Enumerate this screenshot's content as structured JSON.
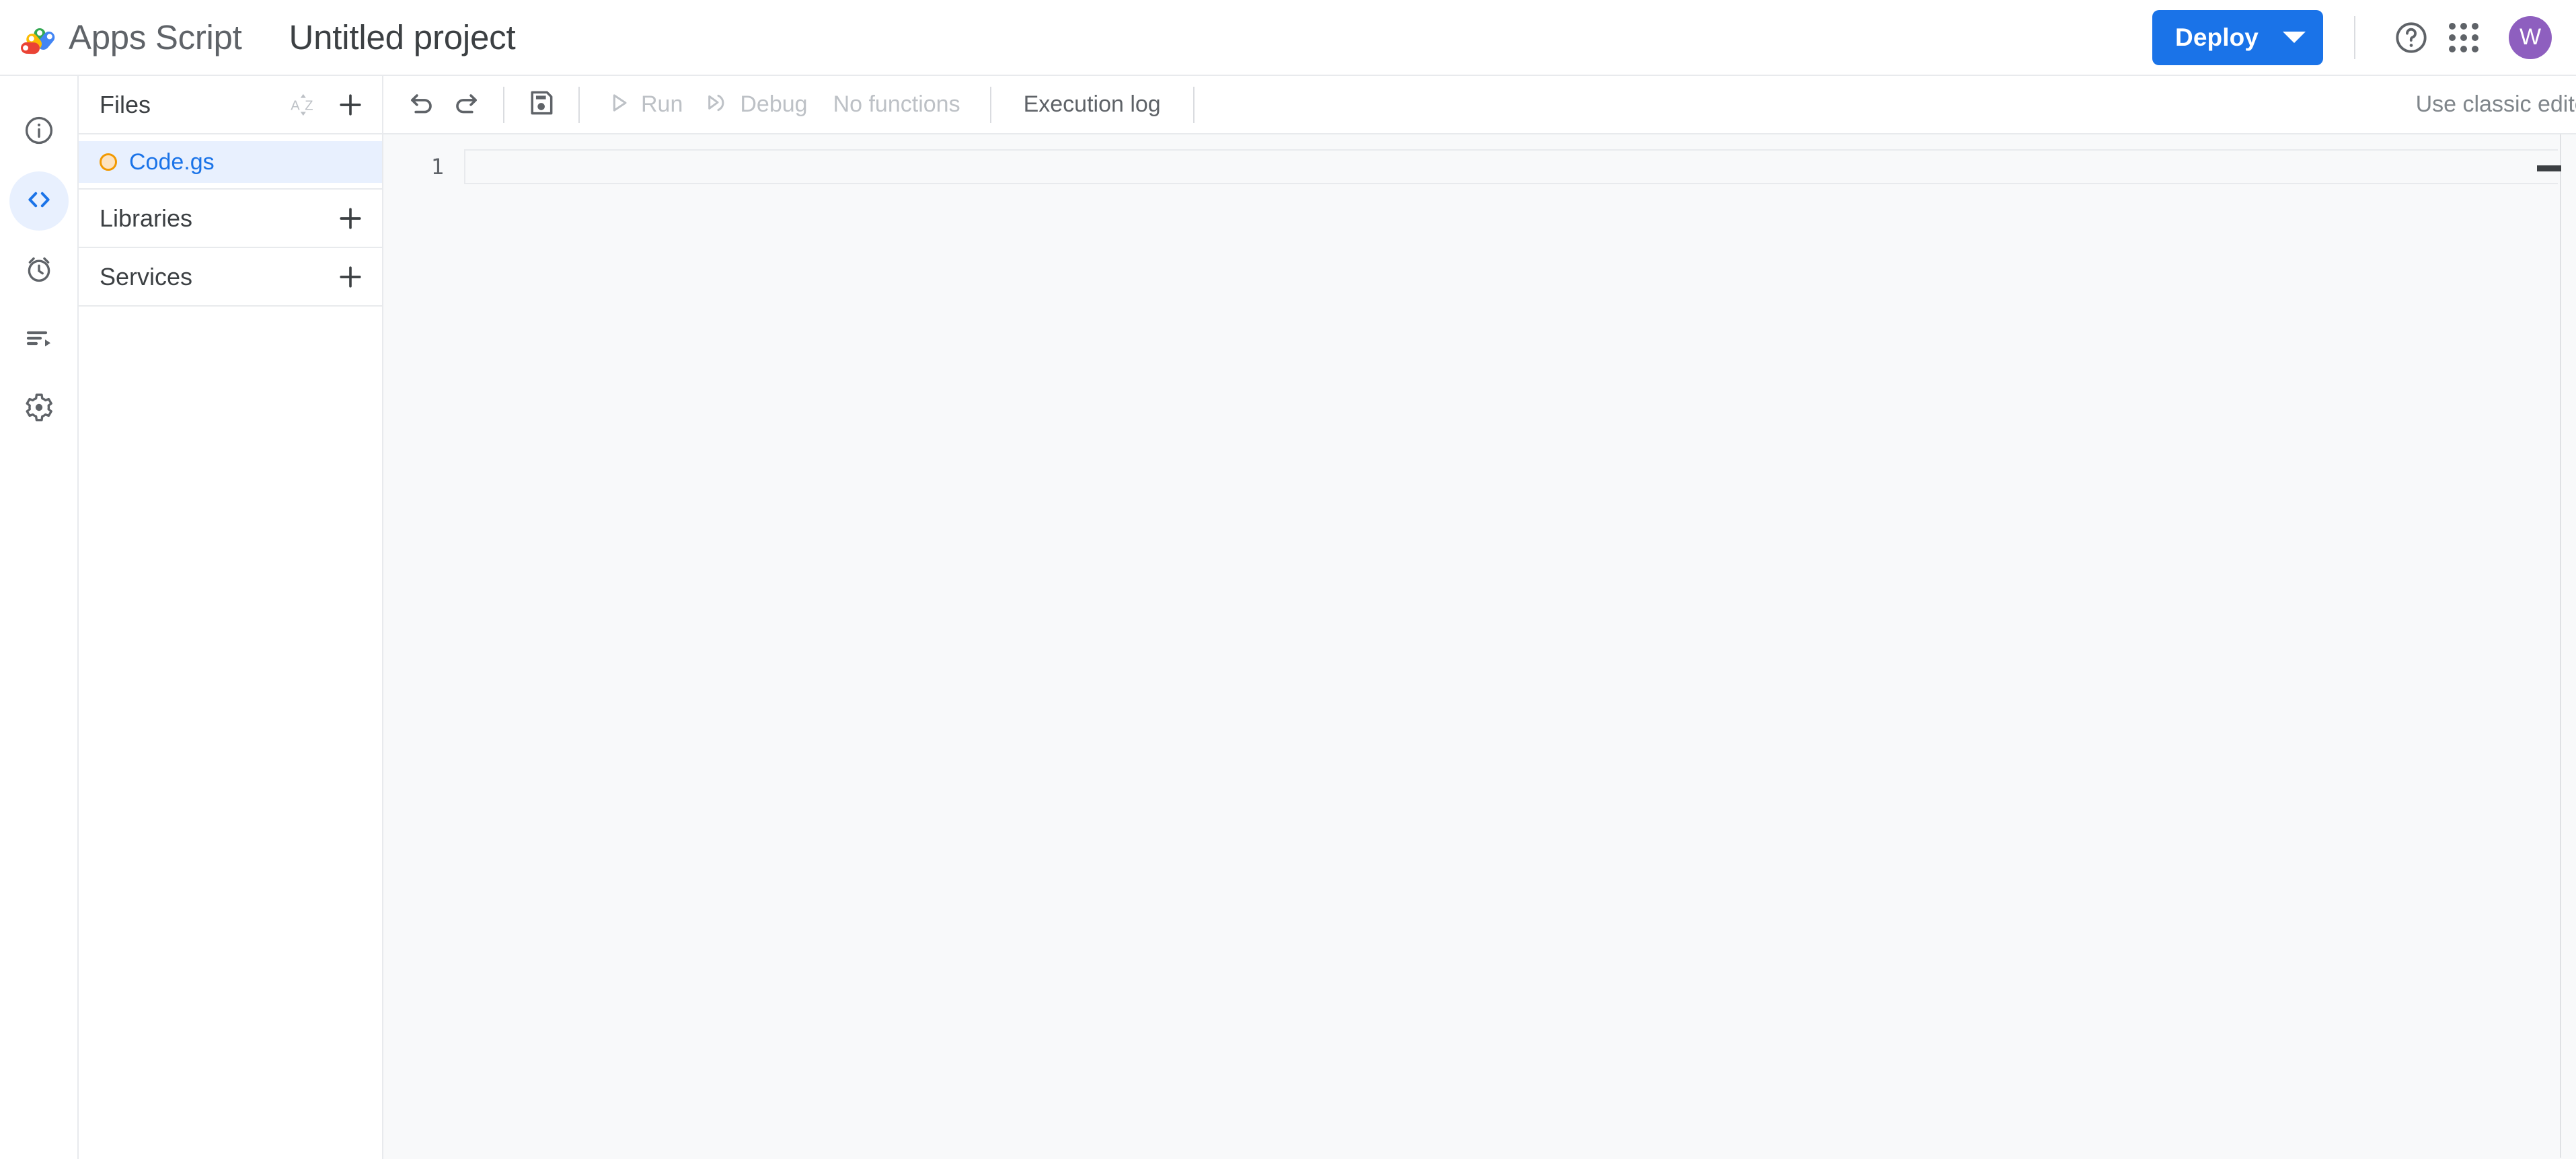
{
  "header": {
    "logo_icon": "apps-script-logo",
    "brand": "Apps Script",
    "project_title": "Untitled project",
    "deploy_label": "Deploy",
    "deploy_caret_icon": "chevron-down-icon",
    "help_icon": "help-circle-icon",
    "apps_icon": "apps-grid-icon",
    "avatar_initial": "W",
    "accent_color": "#1a73e8",
    "avatar_color": "#8e5fbf"
  },
  "rail": {
    "items": [
      {
        "name": "overview",
        "icon": "info-circle-icon",
        "active": false
      },
      {
        "name": "editor",
        "icon": "code-brackets-icon",
        "active": true
      },
      {
        "name": "triggers",
        "icon": "alarm-clock-icon",
        "active": false
      },
      {
        "name": "executions",
        "icon": "executions-list-icon",
        "active": false
      },
      {
        "name": "project-settings",
        "icon": "gear-icon",
        "active": false
      }
    ]
  },
  "files_panel": {
    "files_title": "Files",
    "sort_icon": "sort-az-icon",
    "sort_label": "AZ",
    "add_file_icon": "plus-icon",
    "files": [
      {
        "name": "Code.gs",
        "status_color": "#f29900",
        "selected": true
      }
    ],
    "libraries_title": "Libraries",
    "libraries_add_icon": "plus-icon",
    "services_title": "Services",
    "services_add_icon": "plus-icon"
  },
  "editor_toolbar": {
    "undo_icon": "undo-icon",
    "redo_icon": "redo-icon",
    "save_icon": "save-floppy-icon",
    "run_icon": "play-triangle-icon",
    "run_label": "Run",
    "debug_icon": "debug-step-icon",
    "debug_label": "Debug",
    "functions_label": "No functions",
    "execution_log_label": "Execution log",
    "classic_editor_label": "Use classic editor"
  },
  "code_editor": {
    "line_numbers": [
      "1"
    ],
    "lines": [
      ""
    ]
  }
}
